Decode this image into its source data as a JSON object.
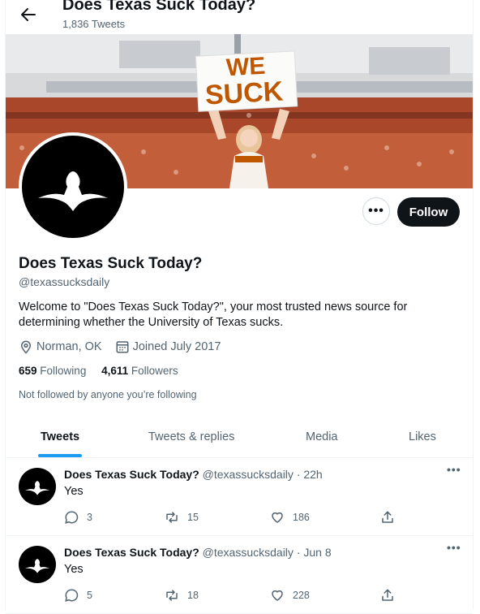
{
  "header": {
    "title": "Does Texas Suck Today?",
    "tweet_count": "1,836 Tweets"
  },
  "banner": {
    "sign_line1": "WE",
    "sign_line2": "SUCK"
  },
  "profile": {
    "name": "Does Texas Suck Today?",
    "handle": "@texassucksdaily",
    "bio": "Welcome to \"Does Texas Suck Today?\", your most trusted news source for determining whether the University of Texas sucks.",
    "location": "Norman, OK",
    "joined": "Joined July 2017",
    "following_count": "659",
    "following_label": "Following",
    "followers_count": "4,611",
    "followers_label": "Followers",
    "not_followed": "Not followed by anyone you’re following",
    "follow_label": "Follow",
    "more_label": "•••"
  },
  "tabs": [
    {
      "label": "Tweets"
    },
    {
      "label": "Tweets & replies"
    },
    {
      "label": "Media"
    },
    {
      "label": "Likes"
    }
  ],
  "tweets": [
    {
      "name": "Does Texas Suck Today?",
      "handle": "@texassucksdaily",
      "time": "· 22h",
      "text": "Yes",
      "replies": "3",
      "retweets": "15",
      "likes": "186"
    },
    {
      "name": "Does Texas Suck Today?",
      "handle": "@texassucksdaily",
      "time": "· Jun 8",
      "text": "Yes",
      "replies": "5",
      "retweets": "18",
      "likes": "228"
    }
  ],
  "colors": {
    "accent": "#1d9bf0",
    "text": "#0f1419",
    "muted": "#536471",
    "burnt_orange": "#bf5700"
  }
}
